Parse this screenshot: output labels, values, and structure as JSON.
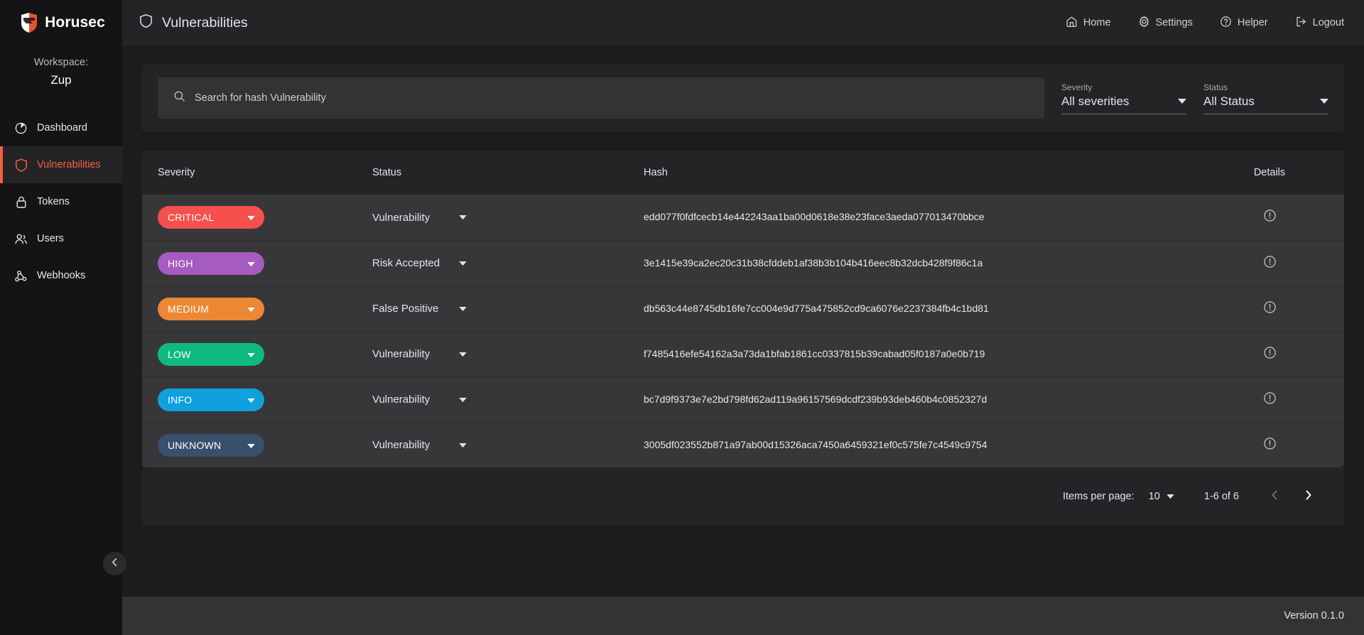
{
  "brand": {
    "name": "Horusec",
    "logo_icon": "horusec-shield-logo"
  },
  "sidebar": {
    "workspace_label": "Workspace:",
    "workspace_name": "Zup",
    "items": [
      {
        "label": "Dashboard",
        "icon": "pie-chart-icon",
        "active": false
      },
      {
        "label": "Vulnerabilities",
        "icon": "shield-icon",
        "active": true
      },
      {
        "label": "Tokens",
        "icon": "lock-icon",
        "active": false
      },
      {
        "label": "Users",
        "icon": "users-icon",
        "active": false
      },
      {
        "label": "Webhooks",
        "icon": "webhook-icon",
        "active": false
      }
    ],
    "collapse_icon": "chevron-left-icon",
    "active_color": "#f4603e"
  },
  "topbar": {
    "page_icon": "shield-icon",
    "title": "Vulnerabilities",
    "links": [
      {
        "label": "Home",
        "icon": "home-icon"
      },
      {
        "label": "Settings",
        "icon": "gear-icon"
      },
      {
        "label": "Helper",
        "icon": "question-circle-icon"
      },
      {
        "label": "Logout",
        "icon": "logout-icon"
      }
    ]
  },
  "filters": {
    "search": {
      "icon": "search-icon",
      "value": "",
      "placeholder": "Search for hash Vulnerability"
    },
    "severity": {
      "label": "Severity",
      "value": "All severities",
      "icon": "chevron-down-icon"
    },
    "status": {
      "label": "Status",
      "value": "All Status",
      "icon": "chevron-down-icon"
    }
  },
  "table": {
    "headers": {
      "severity": "Severity",
      "status": "Status",
      "hash": "Hash",
      "details": "Details"
    },
    "details_icon": "exclamation-circle-icon",
    "rows": [
      {
        "severity": "CRITICAL",
        "severity_color": "#f4504d",
        "status": "Vulnerability",
        "hash": "edd077f0fdfcecb14e442243aa1ba00d0618e38e23face3aeda077013470bbce"
      },
      {
        "severity": "HIGH",
        "severity_color": "#a55bc0",
        "status": "Risk Accepted",
        "hash": "3e1415e39ca2ec20c31b38cfddeb1af38b3b104b416eec8b32dcb428f9f86c1a"
      },
      {
        "severity": "MEDIUM",
        "severity_color": "#ec8733",
        "status": "False Positive",
        "hash": "db563c44e8745db16fe7cc004e9d775a475852cd9ca6076e2237384fb4c1bd81"
      },
      {
        "severity": "LOW",
        "severity_color": "#10b981",
        "status": "Vulnerability",
        "hash": "f7485416efe54162a3a73da1bfab1861cc0337815b39cabad05f0187a0e0b719"
      },
      {
        "severity": "INFO",
        "severity_color": "#10a0dd",
        "status": "Vulnerability",
        "hash": "bc7d9f9373e7e2bd798fd62ad119a96157569dcdf239b93deb460b4c0852327d"
      },
      {
        "severity": "UNKNOWN",
        "severity_color": "#38506b",
        "status": "Vulnerability",
        "hash": "3005df023552b871a97ab00d15326aca7450a6459321ef0c575fe7c4549c9754"
      }
    ]
  },
  "paginator": {
    "items_per_page_label": "Items per page:",
    "items_per_page_value": "10",
    "range_label": "1-6 of 6",
    "prev_icon": "chevron-left-icon",
    "next_icon": "chevron-right-icon"
  },
  "footer": {
    "version": "Version 0.1.0"
  }
}
